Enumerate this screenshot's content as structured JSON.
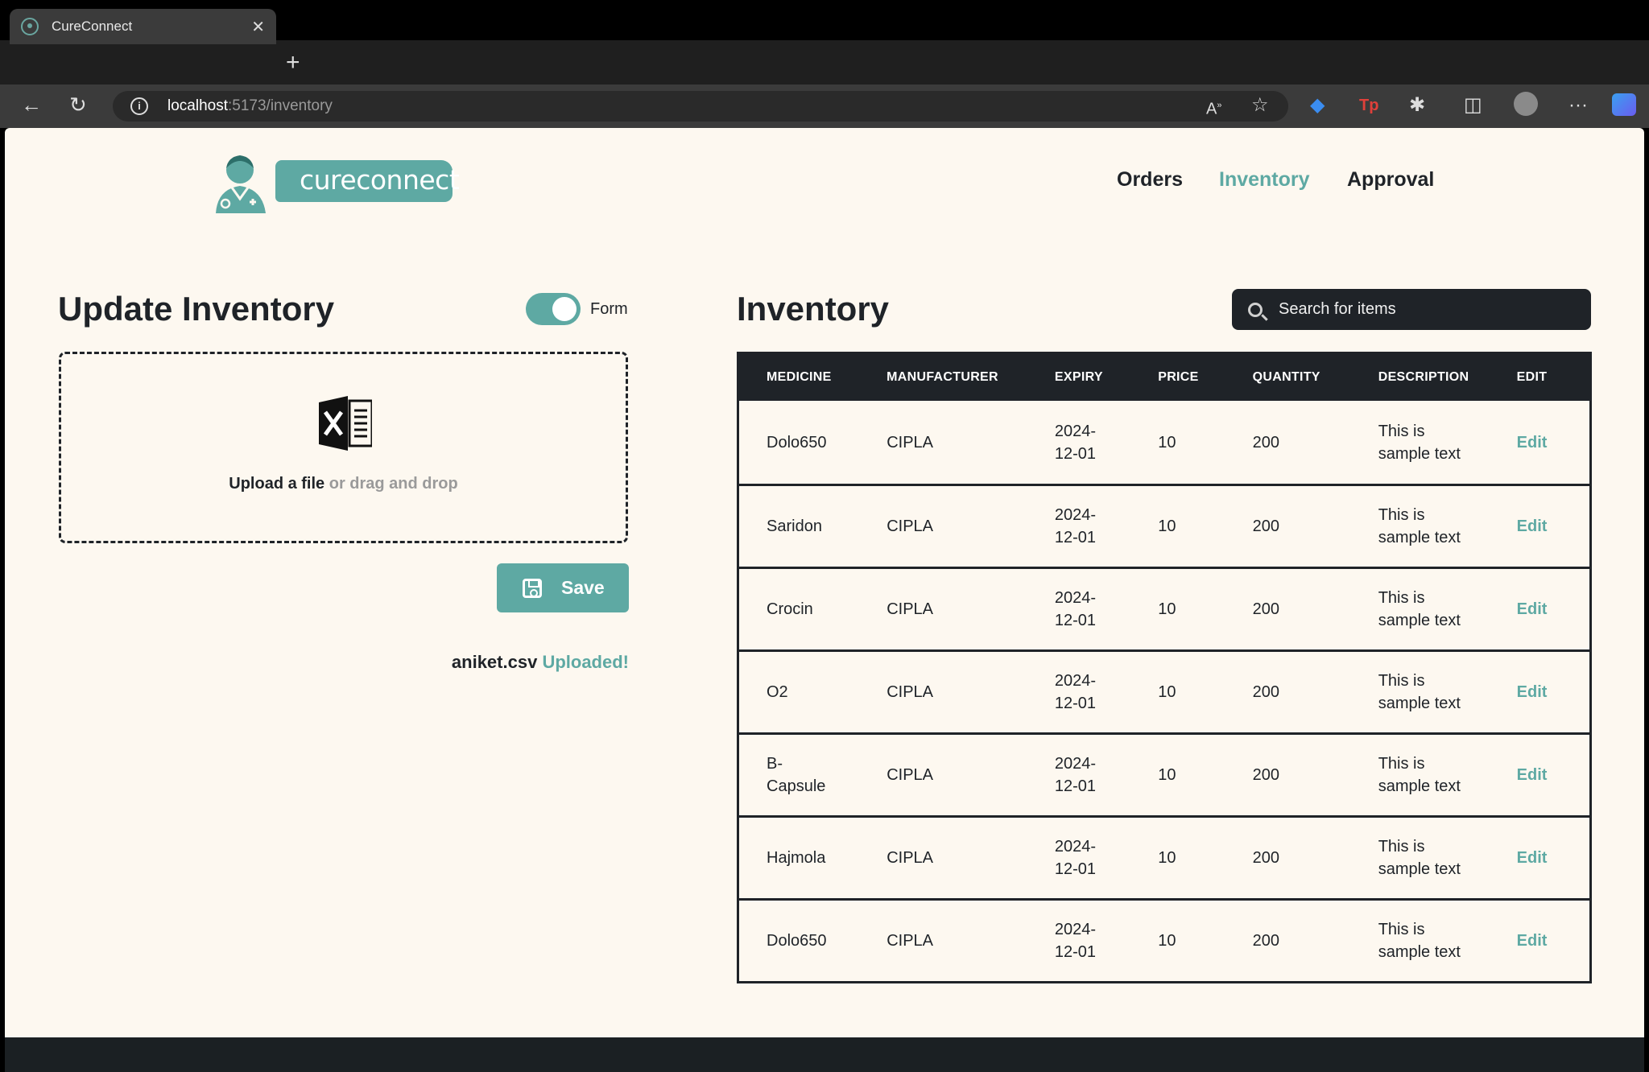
{
  "browser": {
    "tab_title": "CureConnect",
    "tab_close": "✕",
    "new_tab": "+",
    "url_host": "localhost",
    "url_path": ":5173/inventory"
  },
  "header": {
    "logo_text": "cureconnect",
    "nav": [
      {
        "label": "Orders",
        "active": false
      },
      {
        "label": "Inventory",
        "active": true
      },
      {
        "label": "Approval",
        "active": false
      }
    ]
  },
  "update_panel": {
    "title": "Update Inventory",
    "toggle_label": "Form",
    "toggle_on": true,
    "upload_link": "Upload a file",
    "upload_hint": " or drag and drop",
    "file_icon": "excel-file-icon",
    "save_label": "Save",
    "uploaded_file": "aniket.csv",
    "uploaded_status": "Uploaded!"
  },
  "inventory_panel": {
    "title": "Inventory",
    "search_placeholder": "Search for items",
    "columns": [
      "MEDICINE",
      "MANUFACTURER",
      "EXPIRY",
      "PRICE",
      "QUANTITY",
      "DESCRIPTION",
      "EDIT"
    ],
    "rows": [
      {
        "medicine": "Dolo650",
        "manufacturer": "CIPLA",
        "expiry": "2024-12-01",
        "price": "10",
        "quantity": "200",
        "description": "This is sample text",
        "edit": "Edit"
      },
      {
        "medicine": "Saridon",
        "manufacturer": "CIPLA",
        "expiry": "2024-12-01",
        "price": "10",
        "quantity": "200",
        "description": "This is sample text",
        "edit": "Edit"
      },
      {
        "medicine": "Crocin",
        "manufacturer": "CIPLA",
        "expiry": "2024-12-01",
        "price": "10",
        "quantity": "200",
        "description": "This is sample text",
        "edit": "Edit"
      },
      {
        "medicine": "O2",
        "manufacturer": "CIPLA",
        "expiry": "2024-12-01",
        "price": "10",
        "quantity": "200",
        "description": "This is sample text",
        "edit": "Edit"
      },
      {
        "medicine": "B-Capsule",
        "manufacturer": "CIPLA",
        "expiry": "2024-12-01",
        "price": "10",
        "quantity": "200",
        "description": "This is sample text",
        "edit": "Edit"
      },
      {
        "medicine": "Hajmola",
        "manufacturer": "CIPLA",
        "expiry": "2024-12-01",
        "price": "10",
        "quantity": "200",
        "description": "This is sample text",
        "edit": "Edit"
      },
      {
        "medicine": "Dolo650",
        "manufacturer": "CIPLA",
        "expiry": "2024-12-01",
        "price": "10",
        "quantity": "200",
        "description": "This is sample text",
        "edit": "Edit"
      }
    ]
  },
  "colors": {
    "accent": "#5ea9a3",
    "dark": "#1f2328",
    "page_bg": "#fdf8f0"
  }
}
